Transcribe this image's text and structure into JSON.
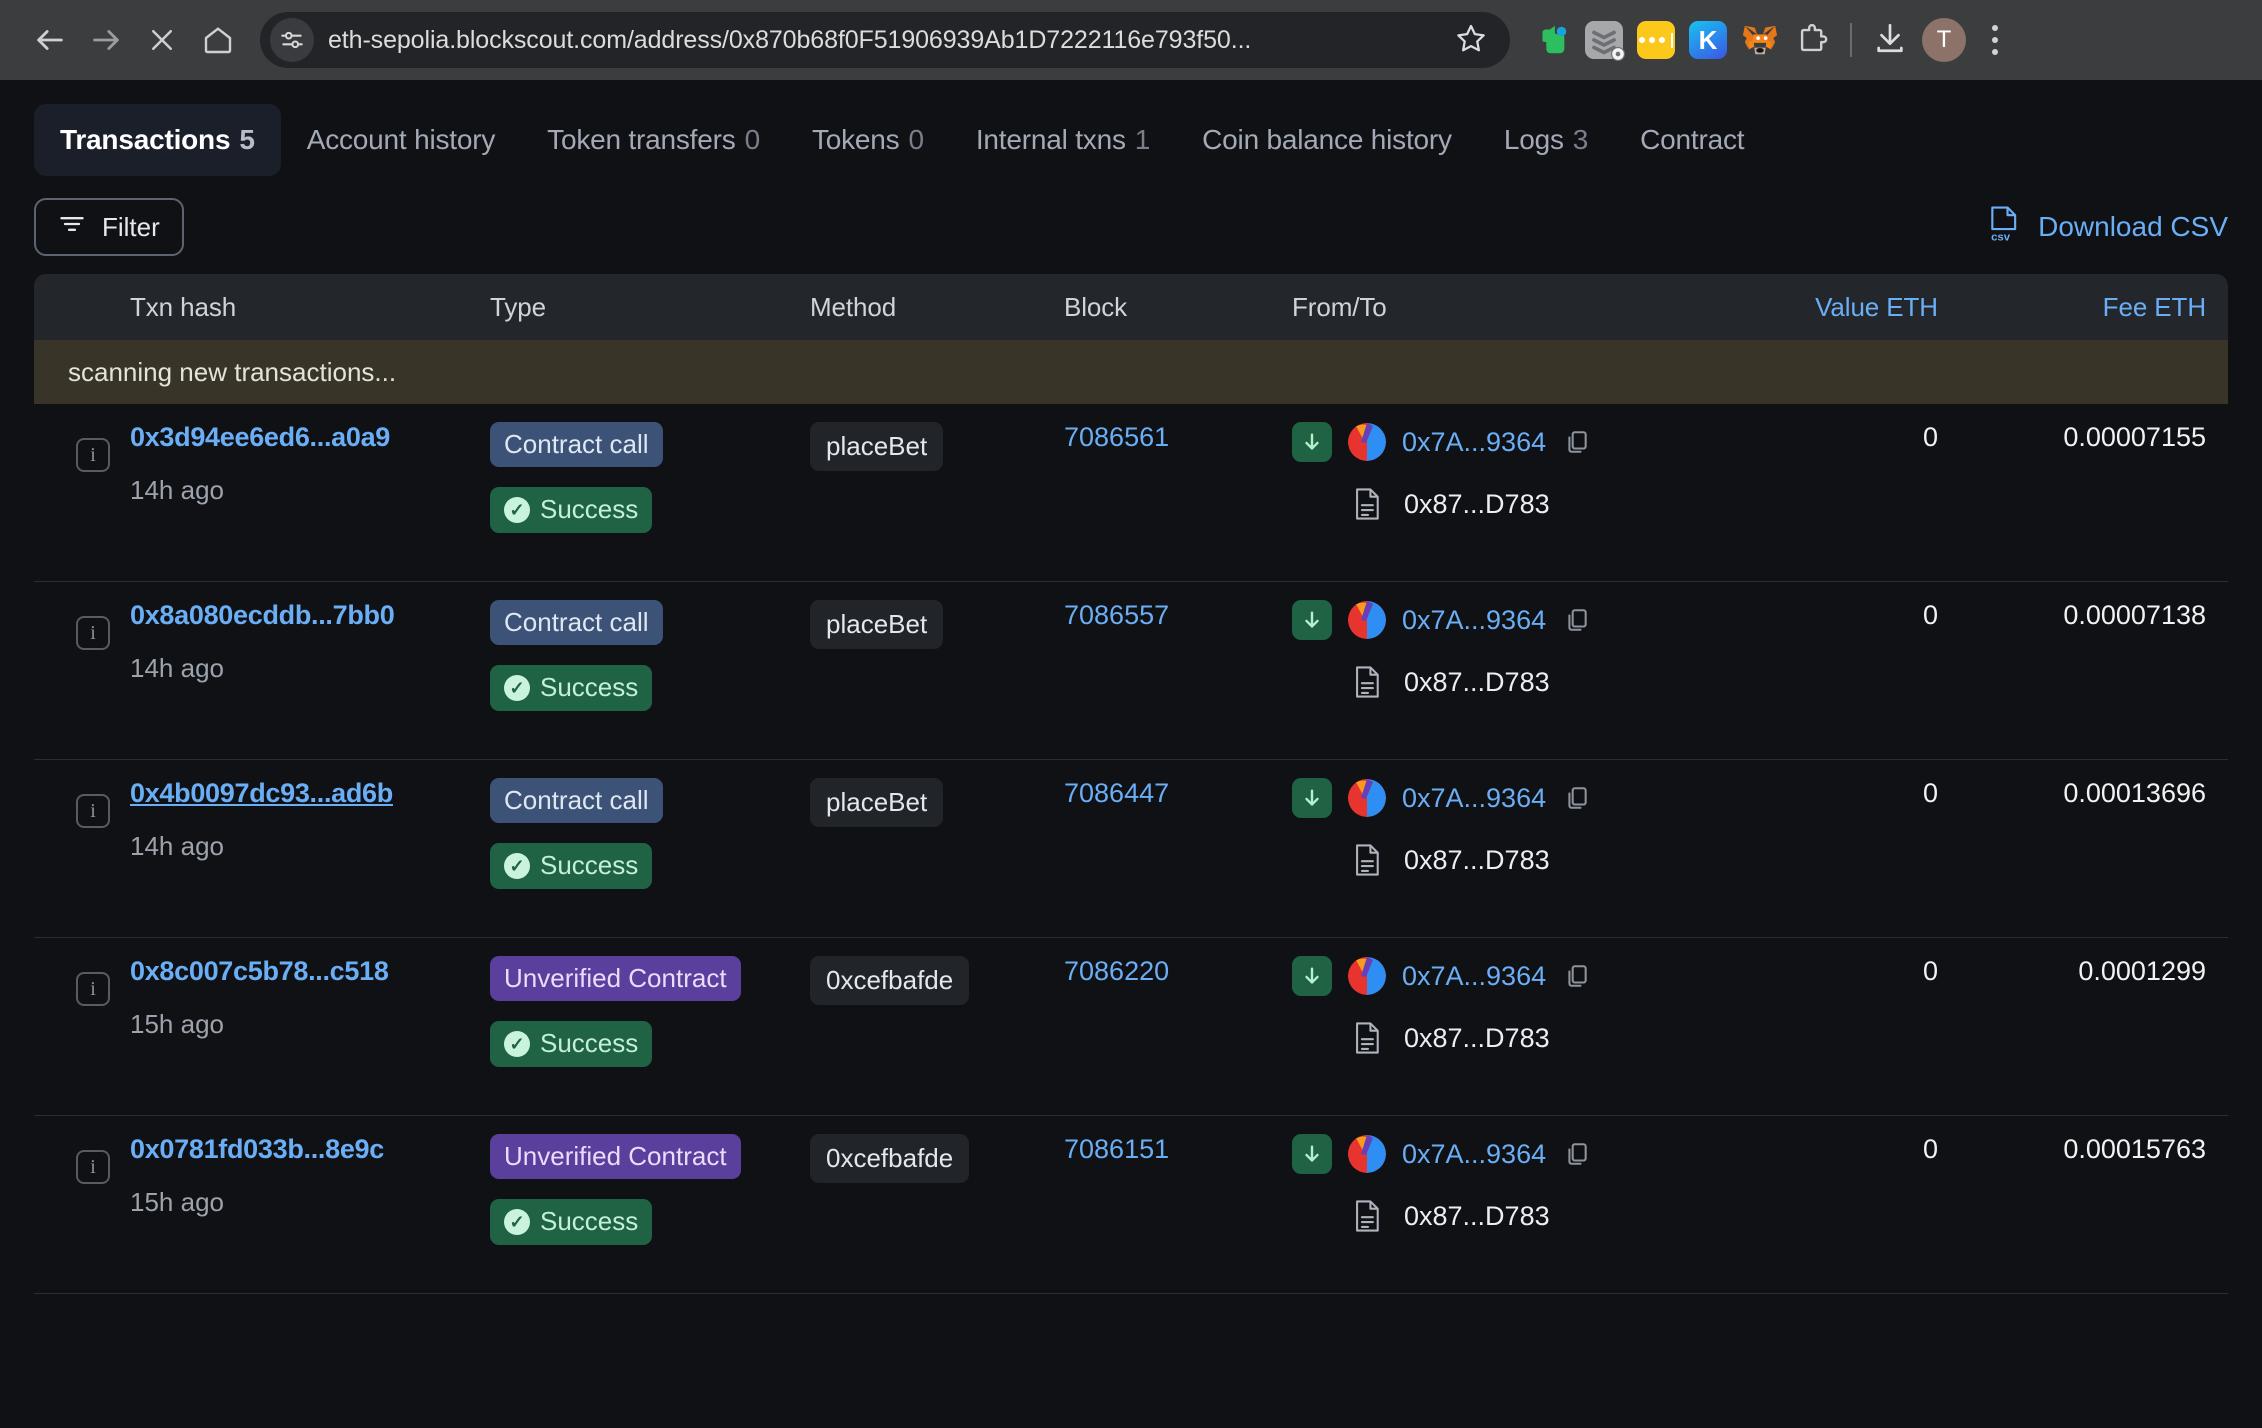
{
  "browser": {
    "back_icon": "back-arrow-icon",
    "forward_icon": "forward-arrow-icon",
    "stop_icon": "stop-icon",
    "home_icon": "home-icon",
    "site_info_icon": "site-settings-icon",
    "url": "eth-sepolia.blockscout.com/address/0x870b68f0F51906939Ab1D7222116e793f50...",
    "bookmark_icon": "star-icon",
    "extensions": [
      {
        "name": "evernote-extension-icon",
        "label": ""
      },
      {
        "name": "todoist-extension-icon",
        "label": ""
      },
      {
        "name": "dots-extension-icon",
        "label": ""
      },
      {
        "name": "keeper-extension-icon",
        "label": "K"
      },
      {
        "name": "metamask-extension-icon",
        "label": ""
      },
      {
        "name": "puzzle-extensions-icon",
        "label": ""
      }
    ],
    "download_icon": "download-icon",
    "profile_initial": "T",
    "menu_icon": "kebab-menu-icon"
  },
  "tabs": [
    {
      "label": "Transactions",
      "count": "5",
      "active": true
    },
    {
      "label": "Account history",
      "count": "",
      "active": false
    },
    {
      "label": "Token transfers",
      "count": "0",
      "active": false
    },
    {
      "label": "Tokens",
      "count": "0",
      "active": false
    },
    {
      "label": "Internal txns",
      "count": "1",
      "active": false
    },
    {
      "label": "Coin balance history",
      "count": "",
      "active": false
    },
    {
      "label": "Logs",
      "count": "3",
      "active": false
    },
    {
      "label": "Contract",
      "count": "",
      "active": false
    }
  ],
  "toolbar": {
    "filter_label": "Filter",
    "filter_icon": "filter-icon",
    "download_csv_label": "Download CSV",
    "csv_icon": "csv-file-icon"
  },
  "table": {
    "headers": {
      "info": "",
      "txn_hash": "Txn hash",
      "type": "Type",
      "method": "Method",
      "block": "Block",
      "from_to": "From/To",
      "value": "Value ETH",
      "fee": "Fee ETH"
    },
    "banner": "scanning new transactions...",
    "rows": [
      {
        "info_icon": "info-icon",
        "hash": "0x3d94ee6ed6...a0a9",
        "hash_hovered": false,
        "age": "14h ago",
        "type": "Contract call",
        "type_style": "contract-call",
        "status": "Success",
        "method": "placeBet",
        "block": "7086561",
        "direction_icon": "arrow-down-in-icon",
        "from_address": "0x7A...9364",
        "copy_icon": "copy-icon",
        "to_icon": "contract-document-icon",
        "to_address": "0x87...D783",
        "value": "0",
        "fee": "0.00007155"
      },
      {
        "info_icon": "info-icon",
        "hash": "0x8a080ecddb...7bb0",
        "hash_hovered": false,
        "age": "14h ago",
        "type": "Contract call",
        "type_style": "contract-call",
        "status": "Success",
        "method": "placeBet",
        "block": "7086557",
        "direction_icon": "arrow-down-in-icon",
        "from_address": "0x7A...9364",
        "copy_icon": "copy-icon",
        "to_icon": "contract-document-icon",
        "to_address": "0x87...D783",
        "value": "0",
        "fee": "0.00007138"
      },
      {
        "info_icon": "info-icon",
        "hash": "0x4b0097dc93...ad6b",
        "hash_hovered": true,
        "age": "14h ago",
        "type": "Contract call",
        "type_style": "contract-call",
        "status": "Success",
        "method": "placeBet",
        "block": "7086447",
        "direction_icon": "arrow-down-in-icon",
        "from_address": "0x7A...9364",
        "copy_icon": "copy-icon",
        "to_icon": "contract-document-icon",
        "to_address": "0x87...D783",
        "value": "0",
        "fee": "0.00013696"
      },
      {
        "info_icon": "info-icon",
        "hash": "0x8c007c5b78...c518",
        "hash_hovered": false,
        "age": "15h ago",
        "type": "Unverified Contract",
        "type_style": "unverified",
        "status": "Success",
        "method": "0xcefbafde",
        "block": "7086220",
        "direction_icon": "arrow-down-in-icon",
        "from_address": "0x7A...9364",
        "copy_icon": "copy-icon",
        "to_icon": "contract-document-icon",
        "to_address": "0x87...D783",
        "value": "0",
        "fee": "0.0001299"
      },
      {
        "info_icon": "info-icon",
        "hash": "0x0781fd033b...8e9c",
        "hash_hovered": false,
        "age": "15h ago",
        "type": "Unverified Contract",
        "type_style": "unverified",
        "status": "Success",
        "method": "0xcefbafde",
        "block": "7086151",
        "direction_icon": "arrow-down-in-icon",
        "from_address": "0x7A...9364",
        "copy_icon": "copy-icon",
        "to_icon": "contract-document-icon",
        "to_address": "0x87...D783",
        "value": "0",
        "fee": "0.00015763"
      }
    ]
  },
  "colors": {
    "link": "#6aaef5",
    "success_bg": "#1f6344",
    "contract_call_bg": "#3c5377",
    "unverified_bg": "#5b3f9c",
    "banner_bg": "#383528",
    "page_bg": "#101114"
  }
}
